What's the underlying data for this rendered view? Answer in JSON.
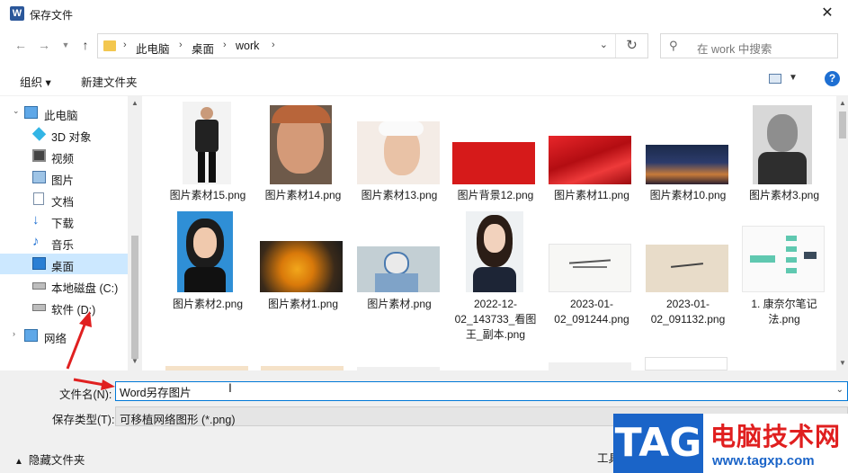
{
  "window": {
    "title": "保存文件",
    "app_icon": "word-icon"
  },
  "address": {
    "crumbs": [
      "此电脑",
      "桌面",
      "work"
    ],
    "search_placeholder": "在 work 中搜索"
  },
  "toolbar": {
    "organize": "组织 ▾",
    "new_folder": "新建文件夹",
    "help": "?"
  },
  "nav": {
    "items": [
      {
        "label": "此电脑",
        "icon": "computer-icon"
      },
      {
        "label": "3D 对象",
        "icon": "cube-icon"
      },
      {
        "label": "视频",
        "icon": "video-icon"
      },
      {
        "label": "图片",
        "icon": "picture-icon"
      },
      {
        "label": "文档",
        "icon": "document-icon"
      },
      {
        "label": "下载",
        "icon": "download-icon"
      },
      {
        "label": "音乐",
        "icon": "music-icon"
      },
      {
        "label": "桌面",
        "icon": "desktop-icon"
      },
      {
        "label": "本地磁盘 (C:)",
        "icon": "drive-icon"
      },
      {
        "label": "软件 (D:)",
        "icon": "drive-icon"
      },
      {
        "label": "网络",
        "icon": "network-icon"
      }
    ]
  },
  "files": [
    {
      "name": "图片素材15.png"
    },
    {
      "name": "图片素材14.png"
    },
    {
      "name": "图片素材13.png"
    },
    {
      "name": "图片背景12.png"
    },
    {
      "name": "图片素材11.png"
    },
    {
      "name": "图片素材10.png"
    },
    {
      "name": "图片素材3.png"
    },
    {
      "name": "图片素材2.png"
    },
    {
      "name": "图片素材1.png"
    },
    {
      "name": "图片素材.png"
    },
    {
      "name": "2022-12-02_143733_看图王_副本.png"
    },
    {
      "name": "2023-01-02_091244.png"
    },
    {
      "name": "2023-01-02_091132.png"
    },
    {
      "name": "1. 康奈尔笔记法.png"
    }
  ],
  "bottom": {
    "filename_label": "文件名(N):",
    "filename_value": "Word另存图片",
    "type_label": "保存类型(T):",
    "type_value": "可移植网络图形 (*.png)",
    "hide_folders": "隐藏文件夹",
    "tools": "工具"
  },
  "watermark": {
    "tag": "TAG",
    "site_cn": "电脑技术网",
    "url": "www.tagxp.com"
  }
}
